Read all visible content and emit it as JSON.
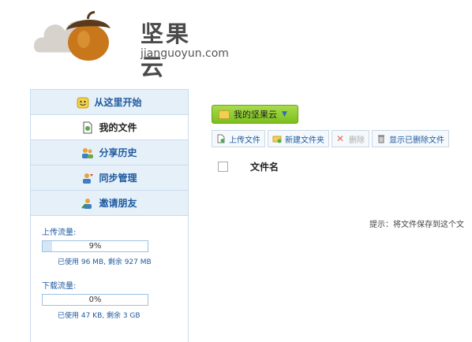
{
  "brand": {
    "cn": "坚果云",
    "en": "jianguoyun.com",
    "colors": {
      "cloud": "#d8d2cd",
      "nut_body": "#c8781b",
      "nut_cap": "#5a3a1c",
      "accent": "#1e5aa0",
      "green": "#7cbf1c"
    }
  },
  "sidebar": {
    "items": [
      {
        "label": "从这里开始",
        "icon": "smiley-icon"
      },
      {
        "label": "我的文件",
        "icon": "file-icon"
      },
      {
        "label": "分享历史",
        "icon": "share-users-icon"
      },
      {
        "label": "同步管理",
        "icon": "sync-user-icon"
      },
      {
        "label": "邀请朋友",
        "icon": "invite-user-icon"
      }
    ],
    "active_index": 1,
    "upload": {
      "title": "上传流量:",
      "percent": "9%",
      "fill_fraction": 0.09,
      "detail": "已使用 96 MB, 剩余 927 MB"
    },
    "download": {
      "title": "下载流量:",
      "percent": "0%",
      "fill_fraction": 0.0,
      "detail": "已使用 47 KB, 剩余 3 GB"
    }
  },
  "main": {
    "root_button": "我的坚果云",
    "toolbar": {
      "upload": "上传文件",
      "new_folder": "新建文件夹",
      "delete": "删除",
      "show_deleted": "显示已删除文件"
    },
    "list_header": {
      "name": "文件名"
    },
    "hint": "提示：将文件保存到这个文"
  }
}
